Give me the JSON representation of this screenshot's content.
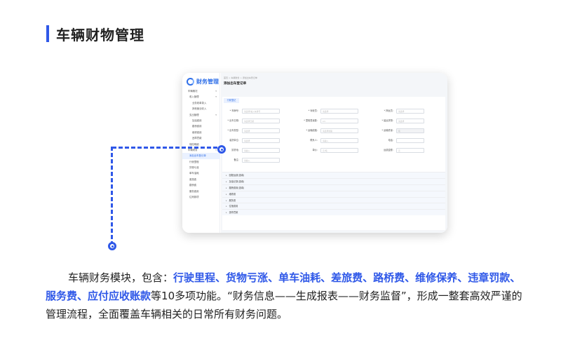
{
  "heading": {
    "title": "车辆财物管理"
  },
  "app": {
    "logo_text": "财务管理",
    "breadcrumb": "首页 > 车辆财务 > 添加出车登记单",
    "page_title": "添加出车登记单",
    "nav": [
      {
        "label": "车辆概况",
        "level": 1,
        "chev": "▾"
      },
      {
        "label": "收入管理",
        "level": 2,
        "chev": "▾"
      },
      {
        "label": "业务收单录入",
        "level": 3
      },
      {
        "label": "其他营业收入",
        "level": 3
      },
      {
        "label": "支出管理",
        "level": 2,
        "chev": "▾"
      },
      {
        "label": "加油费用",
        "level": 3
      },
      {
        "label": "路桥费用",
        "level": 3
      },
      {
        "label": "维修费用",
        "level": 3
      },
      {
        "label": "违章罚款",
        "level": 3
      },
      {
        "label": "保险明细",
        "level": 2
      },
      {
        "label": "车辆财务",
        "level": 1,
        "chev": "▾"
      },
      {
        "label": "添加出车登记单",
        "level": 2,
        "active": true
      },
      {
        "label": "行驶里程",
        "level": 2
      },
      {
        "label": "货物亏涨",
        "level": 2
      },
      {
        "label": "单车油耗",
        "level": 2
      },
      {
        "label": "差旅费",
        "level": 2
      },
      {
        "label": "路桥费",
        "level": 2
      },
      {
        "label": "服务费用",
        "level": 2
      },
      {
        "label": "往来款项",
        "level": 2
      }
    ],
    "section_tab": "行驶登记",
    "form_rows": [
      [
        {
          "label": "* 车牌号：",
          "placeholder": "请选择/输入车牌号"
        },
        {
          "label": "* 驾驶员：",
          "placeholder": "请选择"
        },
        {
          "label": "* 押运员：",
          "placeholder": "请选择"
        }
      ],
      [
        {
          "label": "* 出车日期：",
          "placeholder": "请选择日期"
        },
        {
          "label": "* 里程表读数：",
          "placeholder": "km"
        },
        {
          "label": "* 装运货物：",
          "placeholder": "请选择"
        }
      ],
      [
        {
          "label": "* 出车类型：",
          "placeholder": "请选择"
        },
        {
          "label": "* 运输线路：",
          "placeholder": "请选择线路"
        },
        {
          "label": "* 运输重量：",
          "placeholder": "吨"
        }
      ],
      [
        {
          "label": "装货单位：",
          "placeholder": "请选择"
        },
        {
          "label": "联系人：",
          "placeholder": "请输入"
        },
        {
          "label": "电话：",
          "placeholder": ""
        }
      ],
      [
        {
          "label": "卸货地：",
          "placeholder": "请输入"
        },
        {
          "label": "单价：",
          "placeholder": "元/吨"
        },
        {
          "label": "运费金额：",
          "placeholder": "元"
        }
      ],
      [
        {
          "label": "备注：",
          "placeholder": "请输入"
        }
      ]
    ],
    "accordion": [
      "回程运费(选填)",
      "加油记录(选填)",
      "路桥费用(选填)",
      "维修费",
      "服务费",
      "住宿费用",
      "违章罚款"
    ]
  },
  "description": {
    "lead": "车辆财务模块，包含：",
    "highlights": [
      "行驶里程",
      "货物亏涨",
      "单车油耗",
      "差旅费",
      "路桥费",
      "维修保养",
      "违章罚款",
      "服务费",
      "应付应收账款"
    ],
    "separator": "、",
    "tail": "等10多项功能。“财务信息——生成报表——财务监督”，形成一整套高效严谨的管理流程，全面覆盖车辆相关的日常所有财务问题。"
  }
}
